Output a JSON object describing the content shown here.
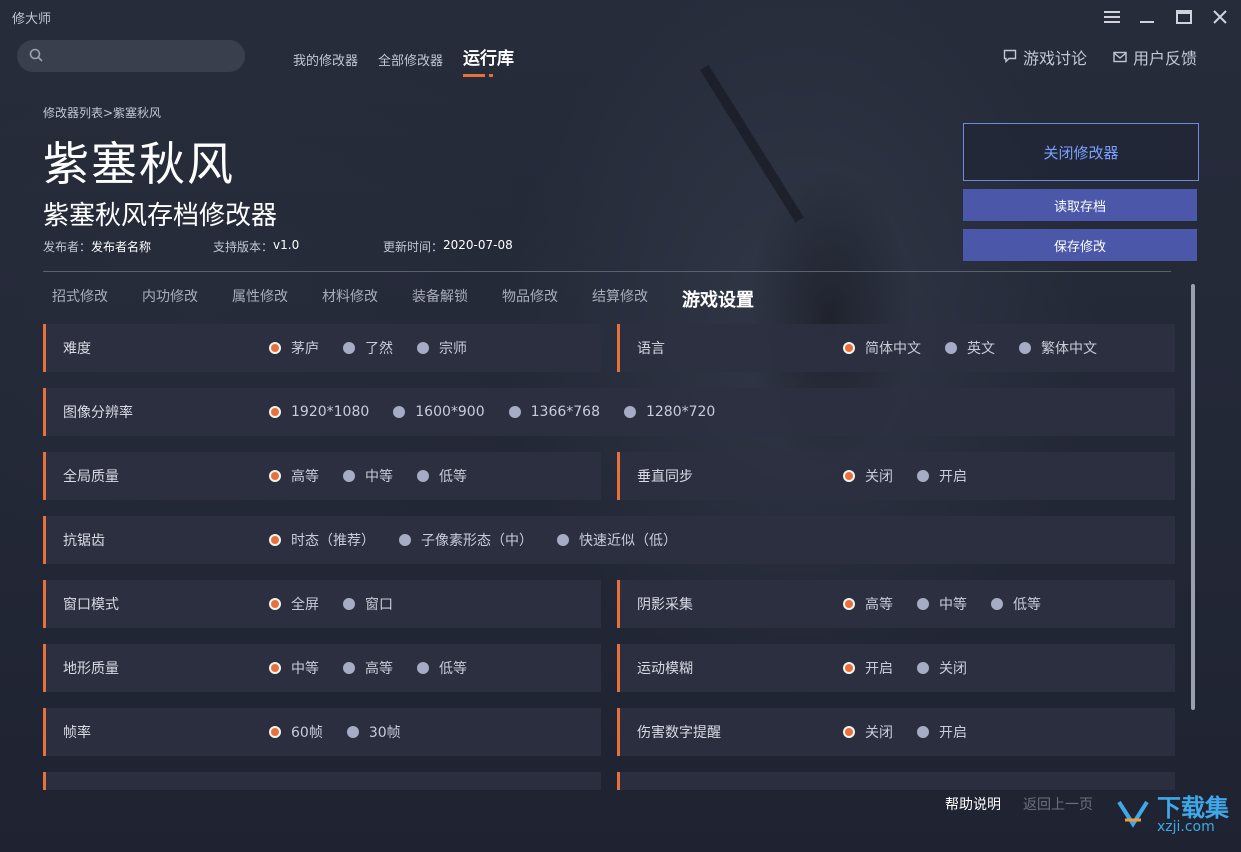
{
  "app": {
    "title": "修大师"
  },
  "window_controls": [
    "menu-icon",
    "minimize-icon",
    "maximize-icon",
    "close-icon"
  ],
  "search": {
    "placeholder": ""
  },
  "nav": {
    "items": [
      "我的修改器",
      "全部修改器",
      "运行库"
    ],
    "active": "运行库"
  },
  "right_nav": {
    "discussion": "游戏讨论",
    "feedback": "用户反馈"
  },
  "breadcrumb": "修改器列表>紫塞秋风",
  "game_title": "紫塞秋风",
  "modifier_title": "紫塞秋风存档修改器",
  "meta": {
    "publisher_label": "发布者：",
    "publisher": "发布者名称",
    "version_label": "支持版本：",
    "version": "v1.0",
    "update_label": "更新时间：",
    "update": "2020-07-08"
  },
  "buttons": {
    "close": "关闭修改器",
    "read_save": "读取存档",
    "save_changes": "保存修改"
  },
  "tabs": [
    "招式修改",
    "内功修改",
    "属性修改",
    "材料修改",
    "装备解锁",
    "物品修改",
    "结算修改",
    "游戏设置"
  ],
  "active_tab": "游戏设置",
  "settings": {
    "difficulty": {
      "label": "难度",
      "options": [
        "茅庐",
        "了然",
        "宗师"
      ]
    },
    "language": {
      "label": "语言",
      "options": [
        "简体中文",
        "英文",
        "繁体中文"
      ]
    },
    "resolution": {
      "label": "图像分辨率",
      "options": [
        "1920*1080",
        "1600*900",
        "1366*768",
        "1280*720"
      ]
    },
    "quality": {
      "label": "全局质量",
      "options": [
        "高等",
        "中等",
        "低等"
      ]
    },
    "vsync": {
      "label": "垂直同步",
      "options": [
        "关闭",
        "开启"
      ]
    },
    "antialias": {
      "label": "抗锯齿",
      "options": [
        "时态（推荐）",
        "子像素形态（中）",
        "快速近似（低）"
      ]
    },
    "window_mode": {
      "label": "窗口模式",
      "options": [
        "全屏",
        "窗口"
      ]
    },
    "shadow": {
      "label": "阴影采集",
      "options": [
        "高等",
        "中等",
        "低等"
      ]
    },
    "terrain": {
      "label": "地形质量",
      "options": [
        "中等",
        "高等",
        "低等"
      ]
    },
    "motion_blur": {
      "label": "运动模糊",
      "options": [
        "开启",
        "关闭"
      ]
    },
    "framerate": {
      "label": "帧率",
      "options": [
        "60帧",
        "30帧"
      ]
    },
    "damage_numbers": {
      "label": "伤害数字提醒",
      "options": [
        "关闭",
        "开启"
      ]
    }
  },
  "footer": {
    "help": "帮助说明",
    "back_top": "返回上一页"
  },
  "watermark": {
    "text": "下载集",
    "sub": "xzji.com"
  },
  "colors": {
    "accent": "#e8703a",
    "button": "#4b57a8",
    "selected_dot": "#e8703a",
    "unselected_dot": "#a6acc6"
  }
}
